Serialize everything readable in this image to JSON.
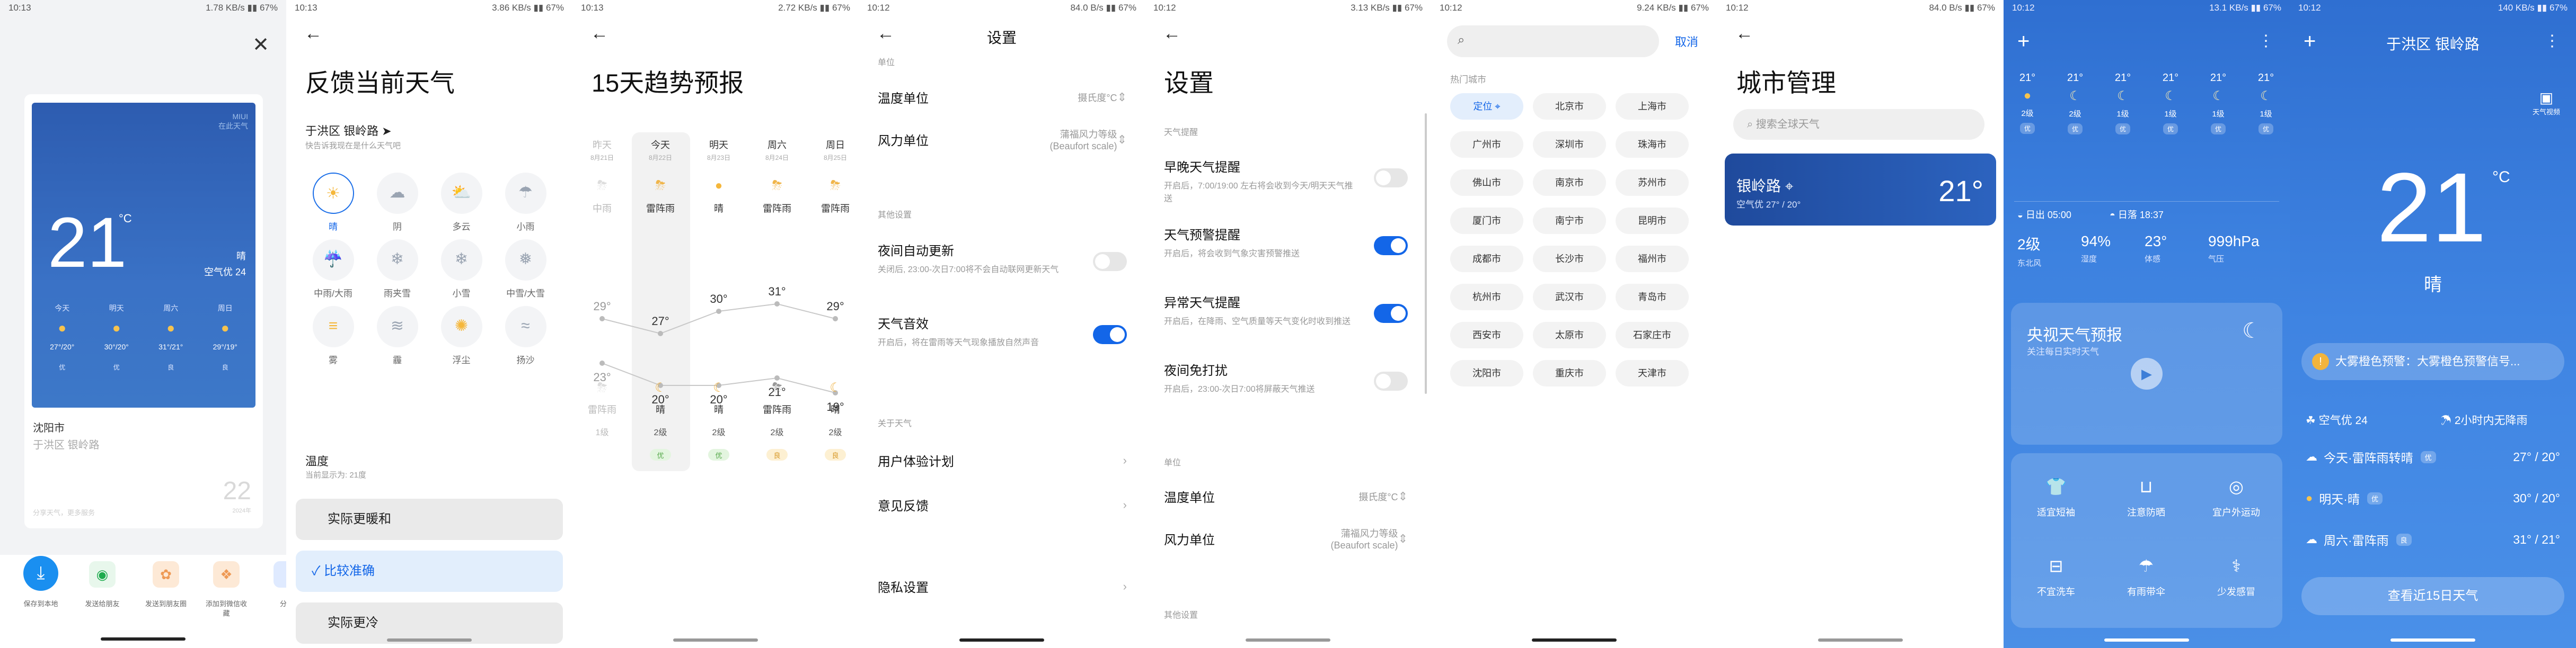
{
  "s1": {
    "status": "10:13",
    "net": "1.78 KB/s",
    "bat": "67%",
    "card": {
      "brand1": "MIUI",
      "brand2": "在此天气",
      "temp": "21",
      "unit": "°C",
      "cond": "晴",
      "aqi": "空气优 24",
      "days": [
        "今天",
        "明天",
        "周六",
        "周日"
      ],
      "temps": [
        "27°/20°",
        "30°/20°",
        "31°/21°",
        "29°/19°"
      ],
      "q": [
        "优",
        "优",
        "良",
        "良"
      ],
      "city": "沈阳市",
      "addr": "于洪区 银岭路",
      "num": "22",
      "foot": "分享天气，更多服务",
      "numsub": "2024年"
    },
    "share": [
      "保存到本地",
      "发送给朋友",
      "发送到朋友圈",
      "添加到微信收藏",
      "分享"
    ]
  },
  "s2": {
    "status": "10:13",
    "net": "3.86 KB/s",
    "title": "反馈当前天气",
    "loc": "于洪区 银岭路",
    "locsub": "快告诉我现在是什么天气吧",
    "wx": [
      "晴",
      "阴",
      "多云",
      "小雨",
      "中雨/大雨",
      "雨夹雪",
      "小雪",
      "中雪/大雪",
      "雾",
      "霾",
      "浮尘",
      "扬沙"
    ],
    "temp_t": "温度",
    "temp_s": "当前显示为: 21度",
    "opts": [
      "实际更暖和",
      "比较准确",
      "实际更冷"
    ]
  },
  "s3": {
    "status": "10:13",
    "net": "2.72 KB/s",
    "title": "15天趋势预报",
    "days": [
      "昨天",
      "今天",
      "明天",
      "周六",
      "周日"
    ],
    "dates": [
      "8月21日",
      "8月22日",
      "8月23日",
      "8月24日",
      "8月25日"
    ],
    "day_wx": [
      "中雨",
      "雷阵雨",
      "晴",
      "雷阵雨",
      "雷阵雨"
    ],
    "highs": [
      29,
      27,
      30,
      31,
      29
    ],
    "lows": [
      23,
      20,
      20,
      21,
      19
    ],
    "night_wx": [
      "雷阵雨",
      "晴",
      "晴",
      "雷阵雨",
      "晴"
    ],
    "winds": [
      "1级",
      "2级",
      "2级",
      "2级",
      "2级"
    ],
    "aq": [
      "",
      "优",
      "优",
      "良",
      "良"
    ]
  },
  "s4": {
    "status": "10:12",
    "net": "84.0 B/s",
    "title": "设置",
    "sec0": "单位",
    "r1": "温度单位",
    "r1v": "摄氏度°C",
    "r2": "风力单位",
    "r2v1": "蒲福风力等级",
    "r2v2": "(Beaufort scale)",
    "sec1": "其他设置",
    "t1": "夜间自动更新",
    "t1s": "关闭后, 23:00-次日7:00将不会自动联网更新天气",
    "t2": "天气音效",
    "t2s": "开启后，将在雷雨等天气现象播放自然声音",
    "sec2": "关于天气",
    "l1": "用户体验计划",
    "l2": "意见反馈",
    "l3": "隐私设置"
  },
  "s5": {
    "status": "10:12",
    "net": "3.13 KB/s",
    "title": "设置",
    "sec": "天气提醒",
    "items": [
      {
        "t": "早晚天气提醒",
        "s": "开启后，7:00/19:00 左右将会收到今天/明天天气推送",
        "on": false
      },
      {
        "t": "天气预警提醒",
        "s": "开启后，将会收到气象灾害预警推送",
        "on": true
      },
      {
        "t": "异常天气提醒",
        "s": "开启后，在降雨、空气质量等天气变化时收到推送",
        "on": true
      },
      {
        "t": "夜间免打扰",
        "s": "开启后，23:00-次日7:00将屏蔽天气推送",
        "on": false
      }
    ],
    "sec2": "单位",
    "r1": "温度单位",
    "r1v": "摄氏度°C",
    "r2": "风力单位",
    "r2v1": "蒲福风力等级",
    "r2v2": "(Beaufort scale)",
    "sec3": "其他设置"
  },
  "s6": {
    "status": "10:12",
    "net": "9.24 KB/s",
    "cancel": "取消",
    "hot": "热门城市",
    "cities": [
      "定位",
      "北京市",
      "上海市",
      "广州市",
      "深圳市",
      "珠海市",
      "佛山市",
      "南京市",
      "苏州市",
      "厦门市",
      "南宁市",
      "昆明市",
      "成都市",
      "长沙市",
      "福州市",
      "杭州市",
      "武汉市",
      "青岛市",
      "西安市",
      "太原市",
      "石家庄市",
      "沈阳市",
      "重庆市",
      "天津市"
    ]
  },
  "s7": {
    "status": "10:12",
    "net": "84.0 B/s",
    "title": "城市管理",
    "search": "搜索全球天气",
    "city": "银岭路",
    "aqi": "空气优  27° / 20°",
    "temp": "21°"
  },
  "s8": {
    "status": "10:12",
    "net": "13.1 KB/s",
    "temps": [
      "21°",
      "21°",
      "21°",
      "21°",
      "21°",
      "21°"
    ],
    "winds": [
      "2级",
      "2级",
      "1级",
      "1级",
      "1级",
      "1级"
    ],
    "q": [
      "优",
      "优",
      "优",
      "优",
      "优",
      "优"
    ],
    "rise": "日出 05:00",
    "set": "日落 18:37",
    "stats": [
      {
        "v": "2级",
        "l": "东北风"
      },
      {
        "v": "94%",
        "l": "湿度"
      },
      {
        "v": "23°",
        "l": "体感"
      },
      {
        "v": "999hPa",
        "l": "气压"
      }
    ],
    "tv": "央视天气预报",
    "tvs": "关注每日实时天气",
    "life": [
      "适宜短袖",
      "注意防晒",
      "宜户外运动",
      "不宜洗车",
      "有雨带伞",
      "少发感冒"
    ]
  },
  "s9": {
    "status": "10:12",
    "net": "140 KB/s",
    "title": "于洪区 银岭路",
    "temp": "21",
    "unit": "°C",
    "cond": "晴",
    "badge": "天气视频",
    "alert": "大雾橙色预警：大雾橙色预警信号...",
    "aqi": "空气优 24",
    "rain": "2小时内无降雨",
    "f": [
      {
        "d": "今天·雷阵雨转晴",
        "q": "优",
        "t": "27° / 20°"
      },
      {
        "d": "明天·晴",
        "q": "优",
        "t": "30° / 20°"
      },
      {
        "d": "周六·雷阵雨",
        "q": "良",
        "t": "31° / 21°"
      }
    ],
    "btn": "查看近15日天气"
  }
}
